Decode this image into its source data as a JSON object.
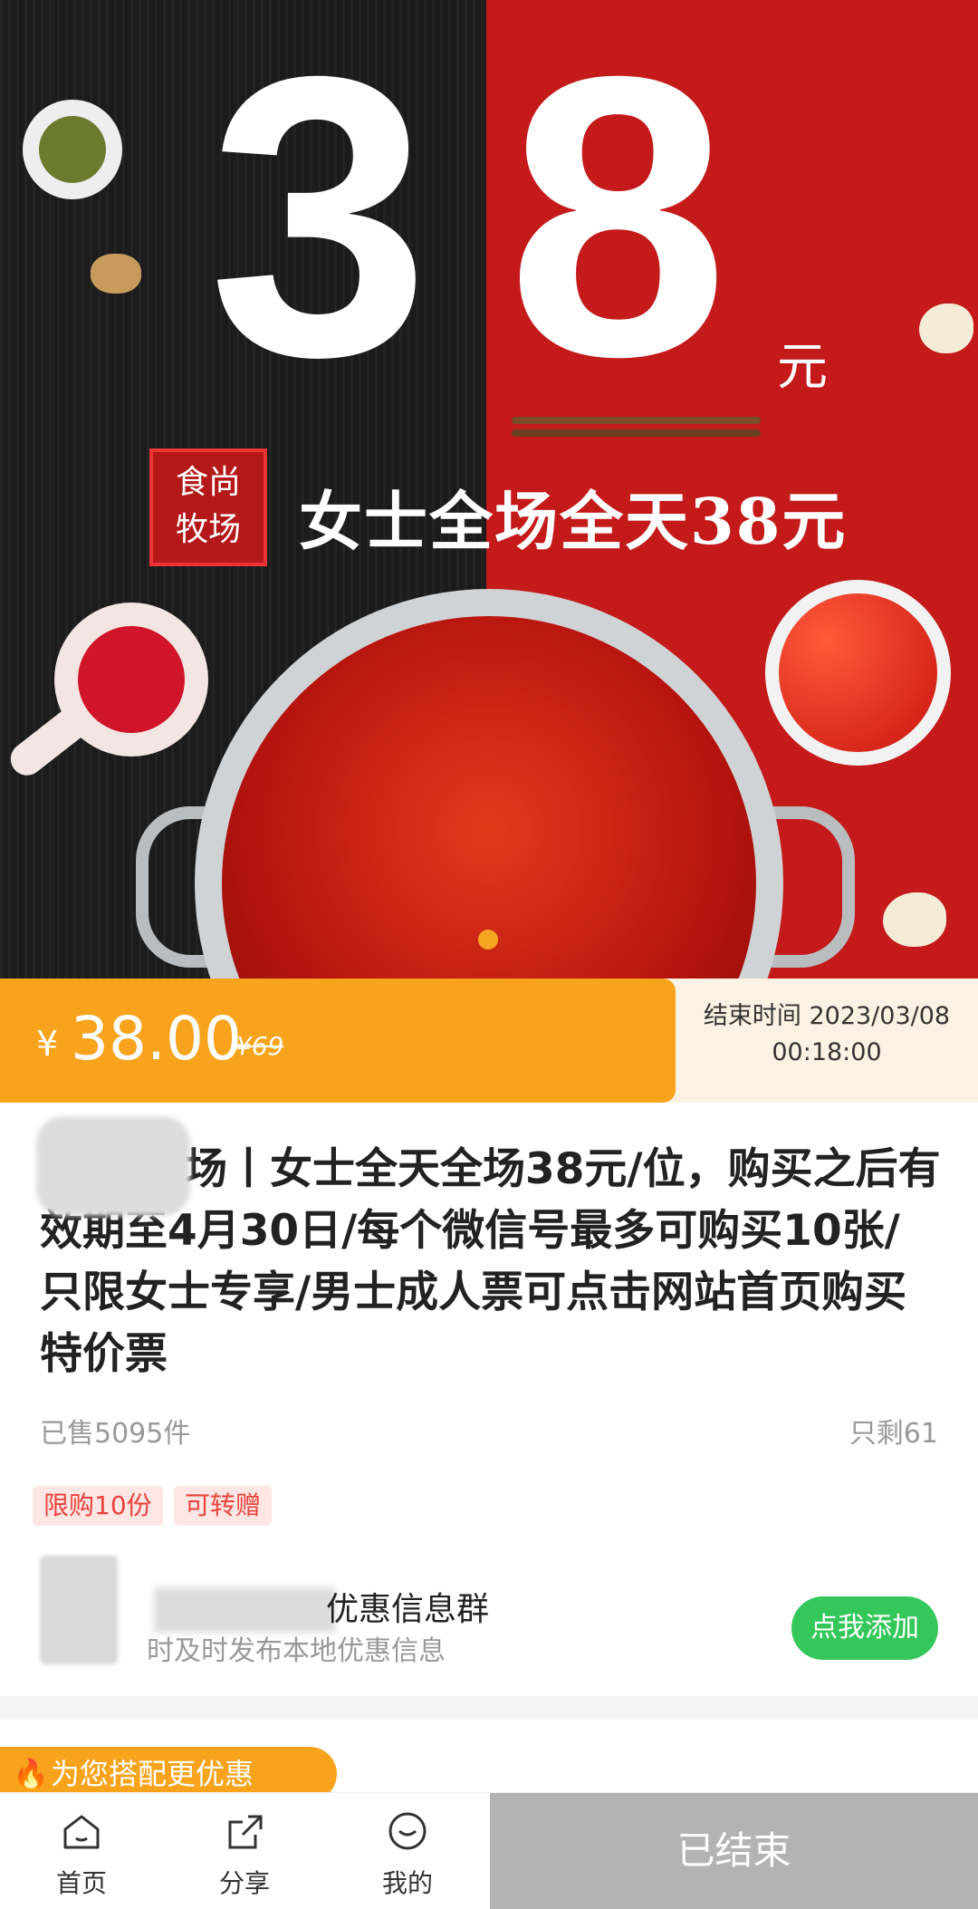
{
  "banner": {
    "digit_left": "3",
    "digit_right": "8",
    "unit": "元",
    "brand_seal": "食尚牧场",
    "slogan": "女士全场全天38元"
  },
  "price": {
    "currency": "¥",
    "current": "38.00",
    "original": "¥69",
    "end_time_label": "结束时间 2023/03/08",
    "end_time_clock": "00:18:00"
  },
  "product": {
    "title": "场丨女士全天全场38元/位，购买之后有效期至4月30日/每个微信号最多可购买10张/只限女士专享/男士成人票可点击网站首页购买特价票",
    "sold": "已售5095件",
    "remaining": "只剩61",
    "tags": [
      "限购10份",
      "可转赠"
    ]
  },
  "group": {
    "title": "优惠信息群",
    "subtitle": "时及时发布本地优惠信息",
    "button": "点我添加"
  },
  "combo": {
    "label": "为您搭配更优惠"
  },
  "bottom_nav": {
    "home": "首页",
    "share": "分享",
    "mine": "我的",
    "status_button": "已结束"
  },
  "colors": {
    "accent_orange": "#f7a31c",
    "green": "#34c759",
    "tag_red": "#e8433c"
  }
}
